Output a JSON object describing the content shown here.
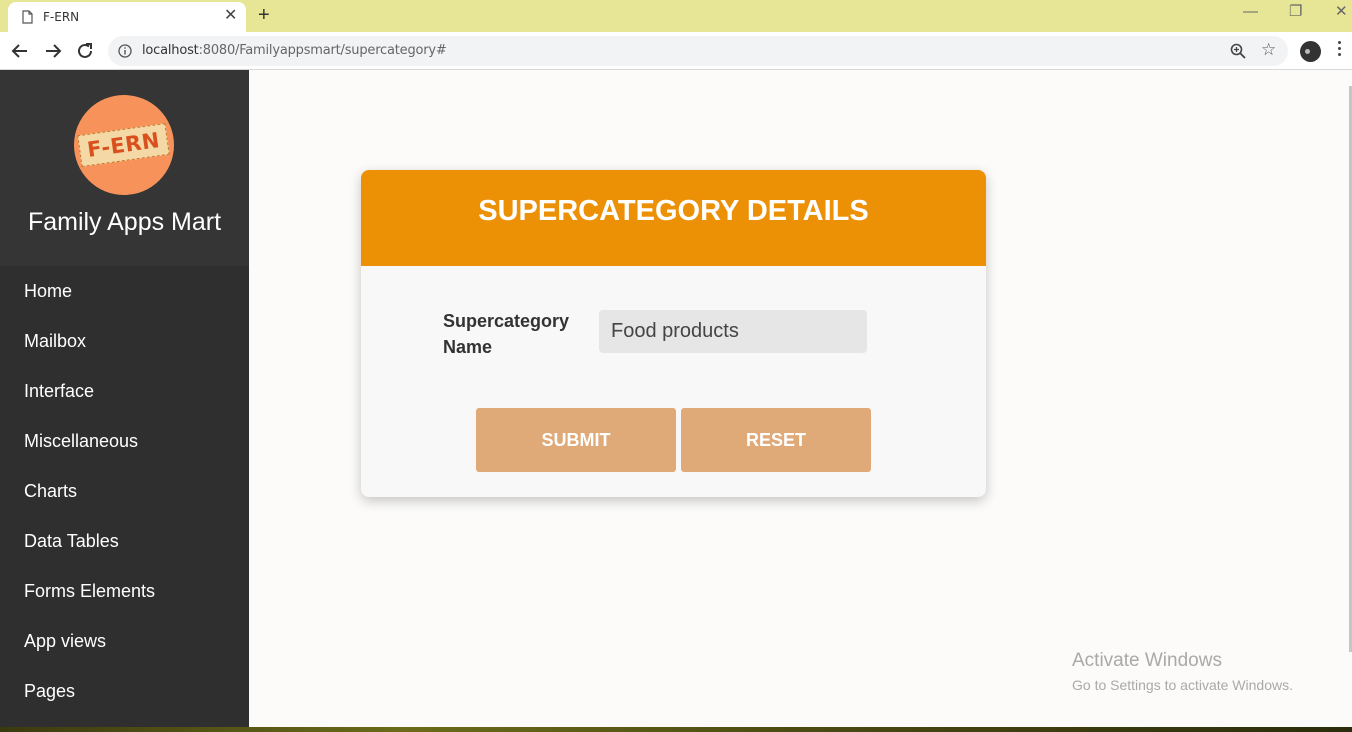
{
  "browser": {
    "tab_title": "F-ERN",
    "tab_close": "✕",
    "new_tab": "+",
    "url_host": "localhost",
    "url_rest": ":8080/Familyappsmart/supercategory#",
    "window_controls": {
      "minimize": "—",
      "restore": "❐",
      "close": "✕"
    }
  },
  "sidebar": {
    "logo_text": "F-ERN",
    "brand_name": "Family Apps Mart",
    "items": [
      {
        "label": "Home"
      },
      {
        "label": "Mailbox"
      },
      {
        "label": "Interface"
      },
      {
        "label": "Miscellaneous"
      },
      {
        "label": "Charts"
      },
      {
        "label": "Data Tables"
      },
      {
        "label": "Forms Elements"
      },
      {
        "label": "App views"
      },
      {
        "label": "Pages"
      }
    ]
  },
  "form": {
    "title": "SUPERCATEGORY DETAILS",
    "field_label": "Supercategory Name",
    "field_value": "Food products",
    "submit_label": "SUBMIT",
    "reset_label": "RESET"
  },
  "watermark": {
    "title": "Activate Windows",
    "subtitle": "Go to Settings to activate Windows."
  },
  "colors": {
    "header_orange": "#ec9006",
    "button_tan": "#e0a978",
    "sidebar_bg": "#2f2f2f",
    "logo_bg": "#f7935a",
    "tabbar": "#e6e696"
  },
  "icons": {
    "tab": "document-icon",
    "back": "back-arrow-icon",
    "forward": "forward-arrow-icon",
    "reload": "reload-icon",
    "info": "info-icon",
    "zoom": "zoom-icon",
    "bookmark": "star-icon",
    "profile": "profile-icon",
    "menu": "kebab-menu-icon"
  }
}
